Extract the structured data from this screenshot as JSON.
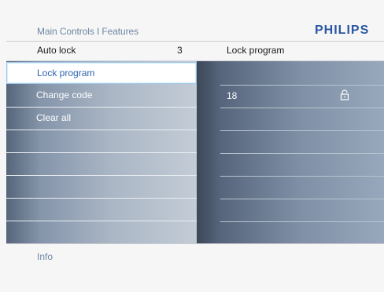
{
  "header": {
    "breadcrumb": "Main Controls I Features",
    "brand": "PHILIPS"
  },
  "subheader": {
    "left_label": "Auto lock",
    "left_value": "3",
    "right_label": "Lock program"
  },
  "menu": {
    "items": [
      {
        "label": "Lock program",
        "selected": true
      },
      {
        "label": "Change code",
        "selected": false
      },
      {
        "label": "Clear all",
        "selected": false
      },
      {
        "label": "",
        "selected": false
      },
      {
        "label": "",
        "selected": false
      },
      {
        "label": "",
        "selected": false
      },
      {
        "label": "",
        "selected": false
      },
      {
        "label": "",
        "selected": false
      }
    ]
  },
  "program_list": {
    "rows": [
      {
        "number": "",
        "lock_icon": "none"
      },
      {
        "number": "18",
        "lock_icon": "unlocked-padlock-icon"
      },
      {
        "number": "",
        "lock_icon": "none"
      },
      {
        "number": "",
        "lock_icon": "none"
      },
      {
        "number": "",
        "lock_icon": "none"
      },
      {
        "number": "",
        "lock_icon": "none"
      },
      {
        "number": "",
        "lock_icon": "none"
      }
    ]
  },
  "footer": {
    "info": "Info"
  },
  "colors": {
    "brand": "#2a56a3",
    "breadcrumb_text": "#6f87a3",
    "selected_text": "#2c63b0"
  }
}
